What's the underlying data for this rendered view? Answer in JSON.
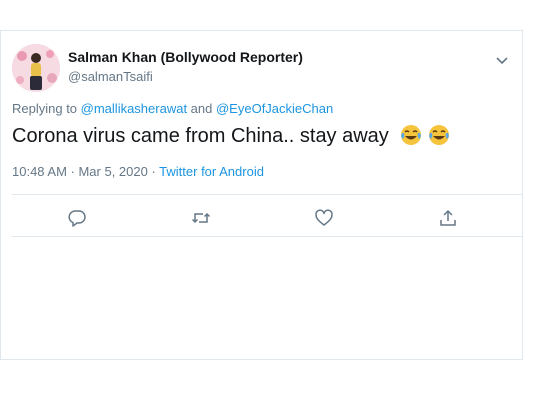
{
  "tweet": {
    "author_name": "Salman Khan (Bollywood Reporter)",
    "author_handle": "@salmanTsaifi",
    "replying_prefix": "Replying to ",
    "replying_user1": "@mallikasherawat",
    "replying_and": " and ",
    "replying_user2": "@EyeOfJackieChan",
    "text": "Corona virus came from China.. stay away",
    "emojis": [
      "face-with-tears-of-joy-icon",
      "face-with-tears-of-joy-icon"
    ],
    "timestamp": "10:48 AM · Mar 5, 2020 · ",
    "source": "Twitter for Android"
  },
  "actions": {
    "icons": [
      "reply-icon",
      "retweet-icon",
      "like-icon",
      "share-icon"
    ]
  },
  "colors": {
    "text": "#14171a",
    "secondary": "#657786",
    "link": "#1b95e0",
    "border": "#e1e8ed"
  }
}
